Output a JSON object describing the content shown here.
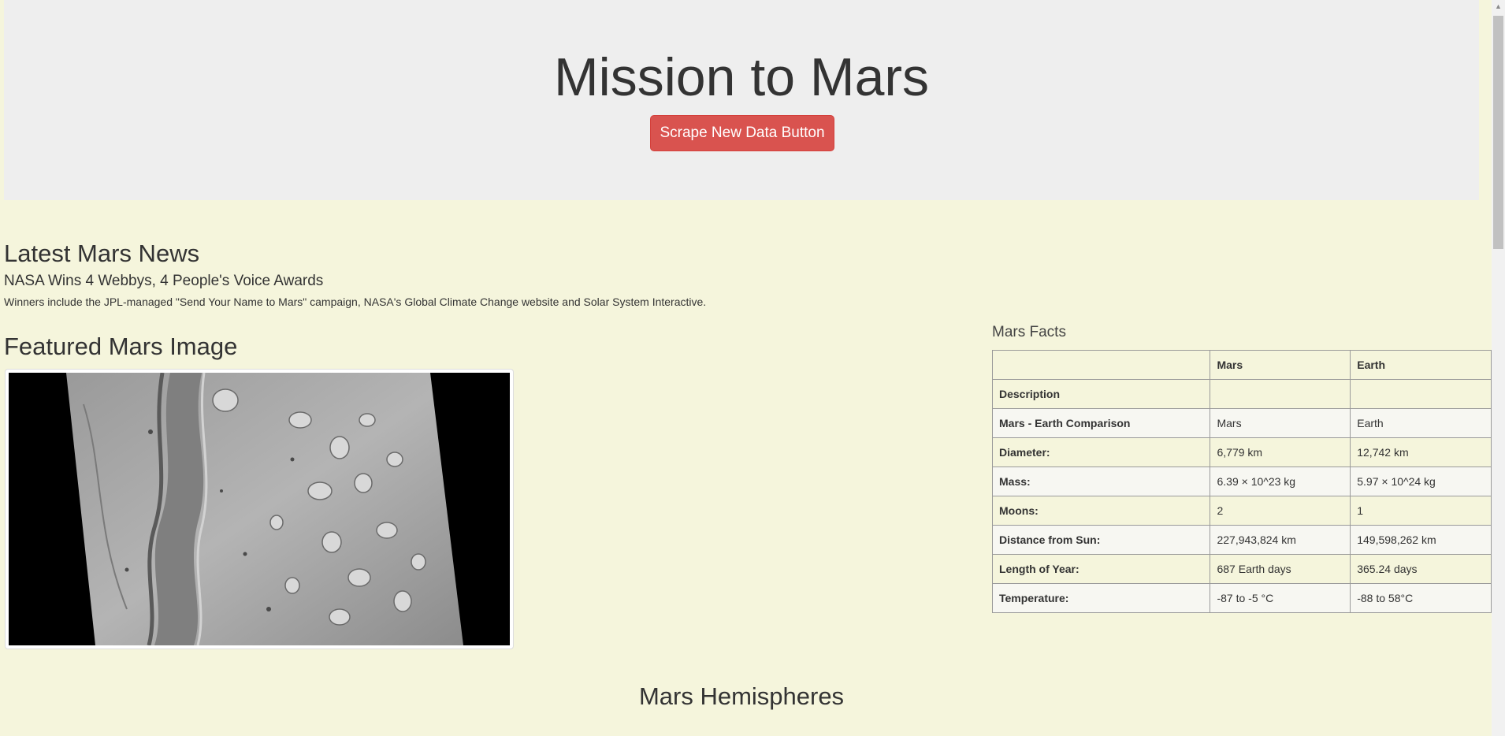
{
  "header": {
    "title": "Mission to Mars",
    "scrape_button": "Scrape New Data Button"
  },
  "news": {
    "heading": "Latest Mars News",
    "title": "NASA Wins 4 Webbys, 4 People's Voice Awards",
    "teaser": "Winners include the JPL-managed \"Send Your Name to Mars\" campaign, NASA's Global Climate Change website and Solar System Interactive."
  },
  "featured": {
    "heading": "Featured Mars Image"
  },
  "facts": {
    "caption": "Mars Facts",
    "columns": [
      "",
      "Mars",
      "Earth"
    ],
    "rows": [
      {
        "label": "Description",
        "mars": "",
        "earth": ""
      },
      {
        "label": "Mars - Earth Comparison",
        "mars": "Mars",
        "earth": "Earth"
      },
      {
        "label": "Diameter:",
        "mars": "6,779 km",
        "earth": "12,742 km"
      },
      {
        "label": "Mass:",
        "mars": "6.39 × 10^23 kg",
        "earth": "5.97 × 10^24 kg"
      },
      {
        "label": "Moons:",
        "mars": "2",
        "earth": "1"
      },
      {
        "label": "Distance from Sun:",
        "mars": "227,943,824 km",
        "earth": "149,598,262 km"
      },
      {
        "label": "Length of Year:",
        "mars": "687 Earth days",
        "earth": "365.24 days"
      },
      {
        "label": "Temperature:",
        "mars": "-87 to -5 °C",
        "earth": "-88 to 58°C"
      }
    ]
  },
  "hemispheres": {
    "heading": "Mars Hemispheres"
  },
  "colors": {
    "page_background": "#f5f5dc",
    "jumbotron_background": "#eeeeee",
    "button_danger": "#d9534f"
  },
  "icons": {
    "scroll_up": "chevron-up-icon"
  }
}
